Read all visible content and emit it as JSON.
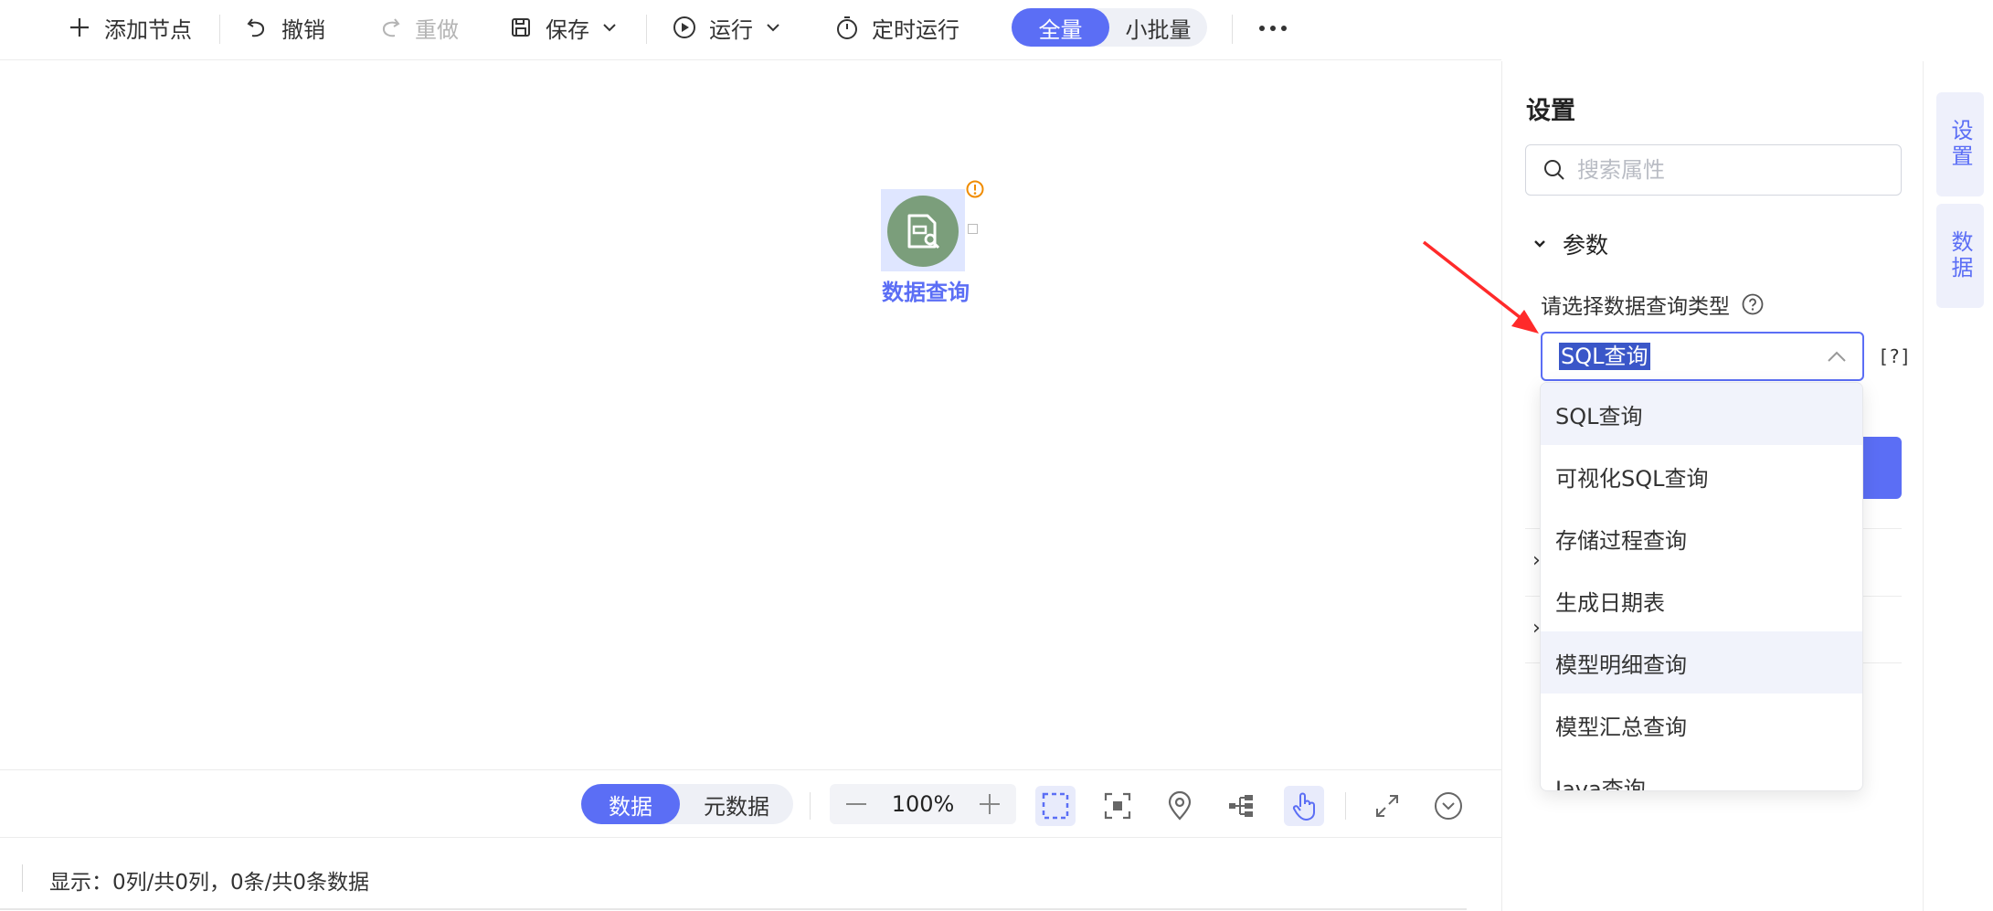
{
  "toolbar": {
    "add_node": "添加节点",
    "undo": "撤销",
    "redo": "重做",
    "save": "保存",
    "run": "运行",
    "scheduled_run": "定时运行",
    "mode_full": "全量",
    "mode_small_batch": "小批量"
  },
  "canvas": {
    "node_label": "数据查询"
  },
  "bottom_toolbar": {
    "tab_data": "数据",
    "tab_metadata": "元数据",
    "zoom_level": "100%"
  },
  "status": {
    "text": "显示：0列/共0列，0条/共0条数据"
  },
  "panel": {
    "title": "设置",
    "search_placeholder": "搜索属性",
    "section_params": "参数",
    "field_label": "请选择数据查询类型",
    "selected_value": "SQL查询",
    "help_box": "[?]"
  },
  "dropdown": {
    "options": [
      "SQL查询",
      "可视化SQL查询",
      "存储过程查询",
      "生成日期表",
      "模型明细查询",
      "模型汇总查询",
      "Java查询"
    ]
  },
  "side_tabs": {
    "settings": "设置",
    "data": "数据"
  },
  "colors": {
    "accent": "#5b6ef5",
    "node_fill": "#7b9e7b",
    "annotation_arrow": "#ff2a2a",
    "warning": "#f08c00"
  }
}
